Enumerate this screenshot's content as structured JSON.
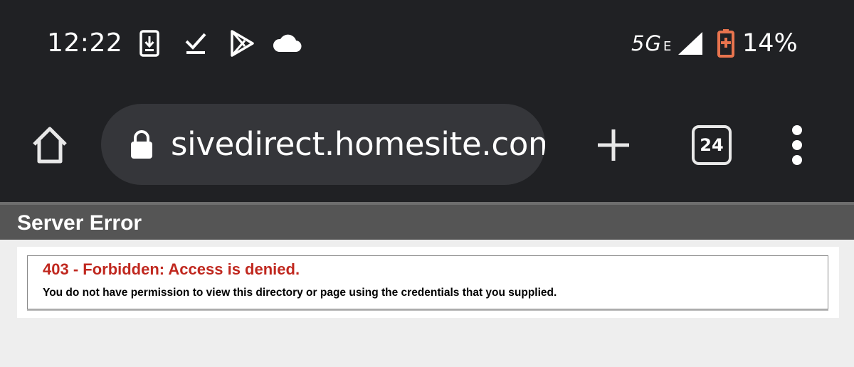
{
  "status_bar": {
    "time": "12:22",
    "network": "5G",
    "network_suffix": "E",
    "battery_percent": "14%",
    "icons": [
      "download-icon",
      "check-download-icon",
      "play-store-icon",
      "cloud-icon",
      "signal-icon",
      "battery-saver-icon"
    ],
    "battery_color": "#e8744e"
  },
  "browser": {
    "url": "sivedirect.homesite.com",
    "tab_count": "24"
  },
  "page": {
    "header": "Server Error",
    "error_title": "403 - Forbidden: Access is denied.",
    "error_message": "You do not have permission to view this directory or page using the credentials that you supplied.",
    "error_color": "#c0281f"
  }
}
